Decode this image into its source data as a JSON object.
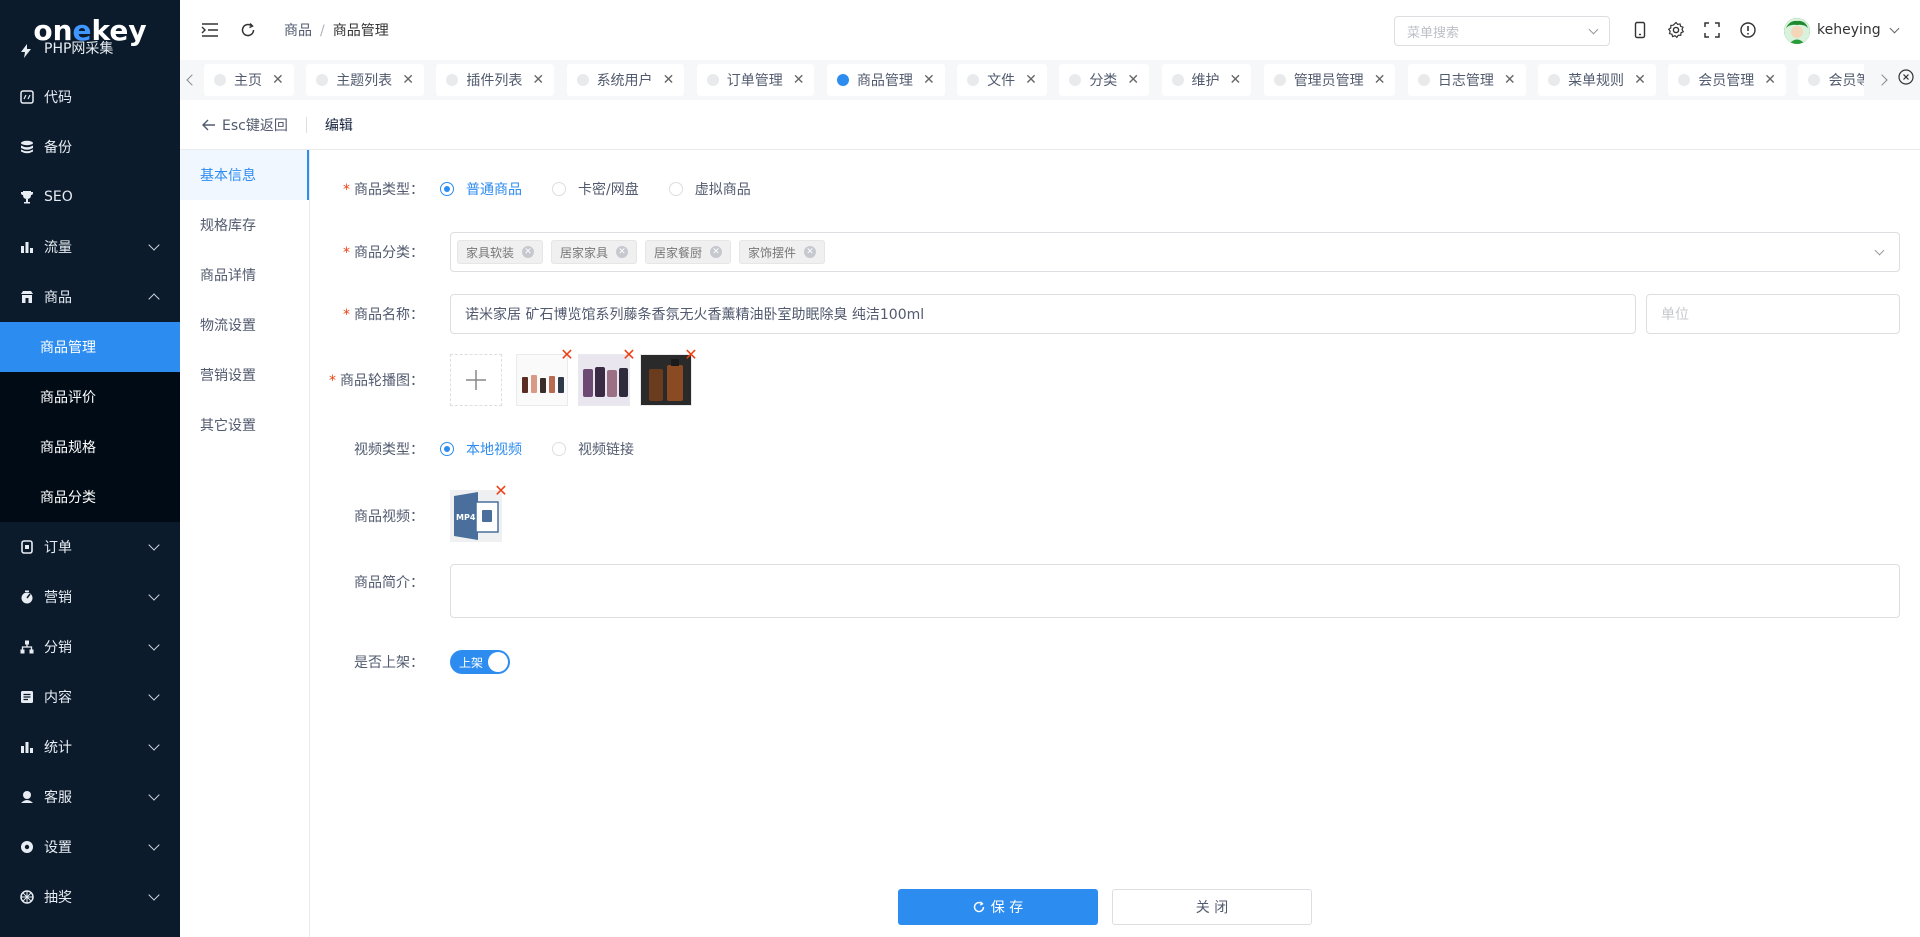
{
  "brand": {
    "logo_prefix": "on",
    "logo_accent": "e",
    "logo_suffix": "key"
  },
  "sidebar": {
    "partial_item": "PHP网采集",
    "items": [
      {
        "label": "代码",
        "icon": "code-icon"
      },
      {
        "label": "备份",
        "icon": "database-icon"
      },
      {
        "label": "SEO",
        "icon": "trophy-icon"
      },
      {
        "label": "流量",
        "icon": "bar-chart-icon"
      },
      {
        "label": "商品",
        "icon": "shop-icon"
      }
    ],
    "sub_items": [
      {
        "label": "商品管理",
        "active": true
      },
      {
        "label": "商品评价"
      },
      {
        "label": "商品规格"
      },
      {
        "label": "商品分类"
      }
    ],
    "items_after": [
      {
        "label": "订单",
        "icon": "order-icon"
      },
      {
        "label": "营销",
        "icon": "marketing-icon"
      },
      {
        "label": "分销",
        "icon": "distribution-icon"
      },
      {
        "label": "内容",
        "icon": "content-icon"
      },
      {
        "label": "统计",
        "icon": "stats-icon"
      },
      {
        "label": "客服",
        "icon": "customer-service-icon"
      },
      {
        "label": "设置",
        "icon": "settings-icon"
      },
      {
        "label": "抽奖",
        "icon": "lottery-icon"
      }
    ]
  },
  "header": {
    "breadcrumb": [
      "商品",
      "/",
      "商品管理"
    ],
    "menu_search_placeholder": "菜单搜索",
    "username": "keheying"
  },
  "tabs": [
    {
      "label": "主页"
    },
    {
      "label": "主题列表"
    },
    {
      "label": "插件列表"
    },
    {
      "label": "系统用户"
    },
    {
      "label": "订单管理"
    },
    {
      "label": "商品管理",
      "active": true
    },
    {
      "label": "文件"
    },
    {
      "label": "分类"
    },
    {
      "label": "维护"
    },
    {
      "label": "管理员管理"
    },
    {
      "label": "日志管理"
    },
    {
      "label": "菜单规则"
    },
    {
      "label": "会员管理"
    },
    {
      "label": "会员等级"
    }
  ],
  "page": {
    "back_label": "Esc键返回",
    "title": "编辑"
  },
  "section_nav": [
    "基本信息",
    "规格库存",
    "商品详情",
    "物流设置",
    "营销设置",
    "其它设置"
  ],
  "form": {
    "product_type": {
      "label": "商品类型：",
      "options": [
        "普通商品",
        "卡密/网盘",
        "虚拟商品"
      ],
      "selected": "普通商品"
    },
    "category": {
      "label": "商品分类：",
      "chips": [
        "家具软装",
        "居家家具",
        "居家餐厨",
        "家饰摆件"
      ]
    },
    "name": {
      "label": "商品名称：",
      "value": "诺米家居 矿石博览馆系列藤条香氛无火香薰精油卧室助眠除臭 纯洁100ml",
      "unit_placeholder": "单位"
    },
    "carousel": {
      "label": "商品轮播图："
    },
    "video_type": {
      "label": "视频类型：",
      "options": [
        "本地视频",
        "视频链接"
      ],
      "selected": "本地视频"
    },
    "video": {
      "label": "商品视频：",
      "badge": "MP4"
    },
    "intro": {
      "label": "商品简介："
    },
    "on_shelf": {
      "label": "是否上架：",
      "text": "上架",
      "value": true
    }
  },
  "actions": {
    "save": "保 存",
    "close": "关 闭"
  }
}
